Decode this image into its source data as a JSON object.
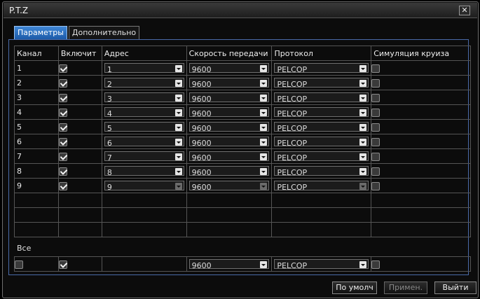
{
  "window": {
    "title": "P.T.Z",
    "close_glyph": "✕"
  },
  "tabs": [
    {
      "label": "Параметры",
      "active": true
    },
    {
      "label": "Дополнительно",
      "active": false
    }
  ],
  "columns": [
    "Канал",
    "Включит",
    "Адрес",
    "Скорость передачи",
    "Протокол",
    "Симуляция круиза"
  ],
  "rows": [
    {
      "channel": "1",
      "enabled": true,
      "address": "1",
      "baud": "9600",
      "protocol": "PELCOP",
      "cruise": false
    },
    {
      "channel": "2",
      "enabled": true,
      "address": "2",
      "baud": "9600",
      "protocol": "PELCOP",
      "cruise": false
    },
    {
      "channel": "3",
      "enabled": true,
      "address": "3",
      "baud": "9600",
      "protocol": "PELCOP",
      "cruise": false
    },
    {
      "channel": "4",
      "enabled": true,
      "address": "4",
      "baud": "9600",
      "protocol": "PELCOP",
      "cruise": false
    },
    {
      "channel": "5",
      "enabled": true,
      "address": "5",
      "baud": "9600",
      "protocol": "PELCOP",
      "cruise": false
    },
    {
      "channel": "6",
      "enabled": true,
      "address": "6",
      "baud": "9600",
      "protocol": "PELCOP",
      "cruise": false
    },
    {
      "channel": "7",
      "enabled": true,
      "address": "7",
      "baud": "9600",
      "protocol": "PELCOP",
      "cruise": false
    },
    {
      "channel": "8",
      "enabled": true,
      "address": "8",
      "baud": "9600",
      "protocol": "PELCOP",
      "cruise": false
    },
    {
      "channel": "9",
      "enabled": true,
      "address": "9",
      "baud": "9600",
      "protocol": "PELCOP",
      "cruise": false
    }
  ],
  "all": {
    "label": "Все",
    "select_all": false,
    "enabled": true,
    "baud": "9600",
    "protocol": "PELCOP",
    "cruise": false
  },
  "buttons": {
    "default_label": "По умолч",
    "apply_label": "Примен.",
    "exit_label": "Выйти"
  },
  "colors": {
    "tab_active": "#1c5aa8",
    "panel_border": "#4a6aa8"
  }
}
